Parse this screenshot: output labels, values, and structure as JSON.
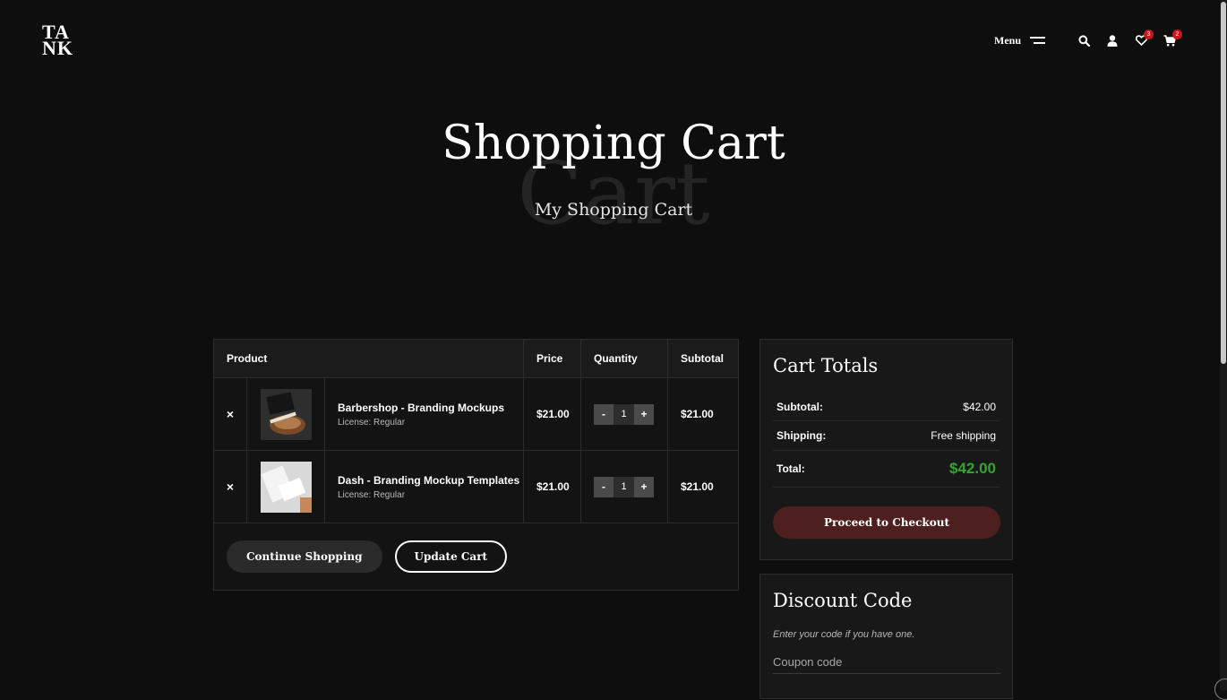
{
  "header": {
    "logo_line1": "TA",
    "logo_line2": "NK",
    "menu_label": "Menu",
    "wishlist_count": "3",
    "cart_count": "2"
  },
  "hero": {
    "ghost_text": "Cart",
    "title": "Shopping Cart",
    "subtitle": "My Shopping Cart"
  },
  "cart": {
    "columns": {
      "product": "Product",
      "price": "Price",
      "quantity": "Quantity",
      "subtotal": "Subtotal"
    },
    "items": [
      {
        "remove": "×",
        "name": "Barbershop - Branding Mockups",
        "license": "License: Regular",
        "price": "$21.00",
        "qty": "1",
        "subtotal": "$21.00"
      },
      {
        "remove": "×",
        "name": "Dash - Branding Mockup Templates",
        "license": "License: Regular",
        "price": "$21.00",
        "qty": "1",
        "subtotal": "$21.00"
      }
    ],
    "qty_minus": "-",
    "qty_plus": "+",
    "continue_label": "Continue Shopping",
    "update_label": "Update Cart"
  },
  "totals": {
    "title": "Cart Totals",
    "subtotal_label": "Subtotal:",
    "subtotal_value": "$42.00",
    "shipping_label": "Shipping:",
    "shipping_value": "Free shipping",
    "total_label": "Total:",
    "total_value": "$42.00",
    "checkout_label": "Proceed to Checkout"
  },
  "discount": {
    "title": "Discount Code",
    "hint": "Enter your code if you have one.",
    "placeholder": "Coupon code"
  },
  "colors": {
    "accent_green": "#35a52f",
    "checkout_bg": "#4e1f1f",
    "badge_red": "#c8161d"
  },
  "icons": [
    "search-icon",
    "user-icon",
    "heart-icon",
    "cart-icon",
    "hamburger-icon",
    "remove-icon"
  ]
}
